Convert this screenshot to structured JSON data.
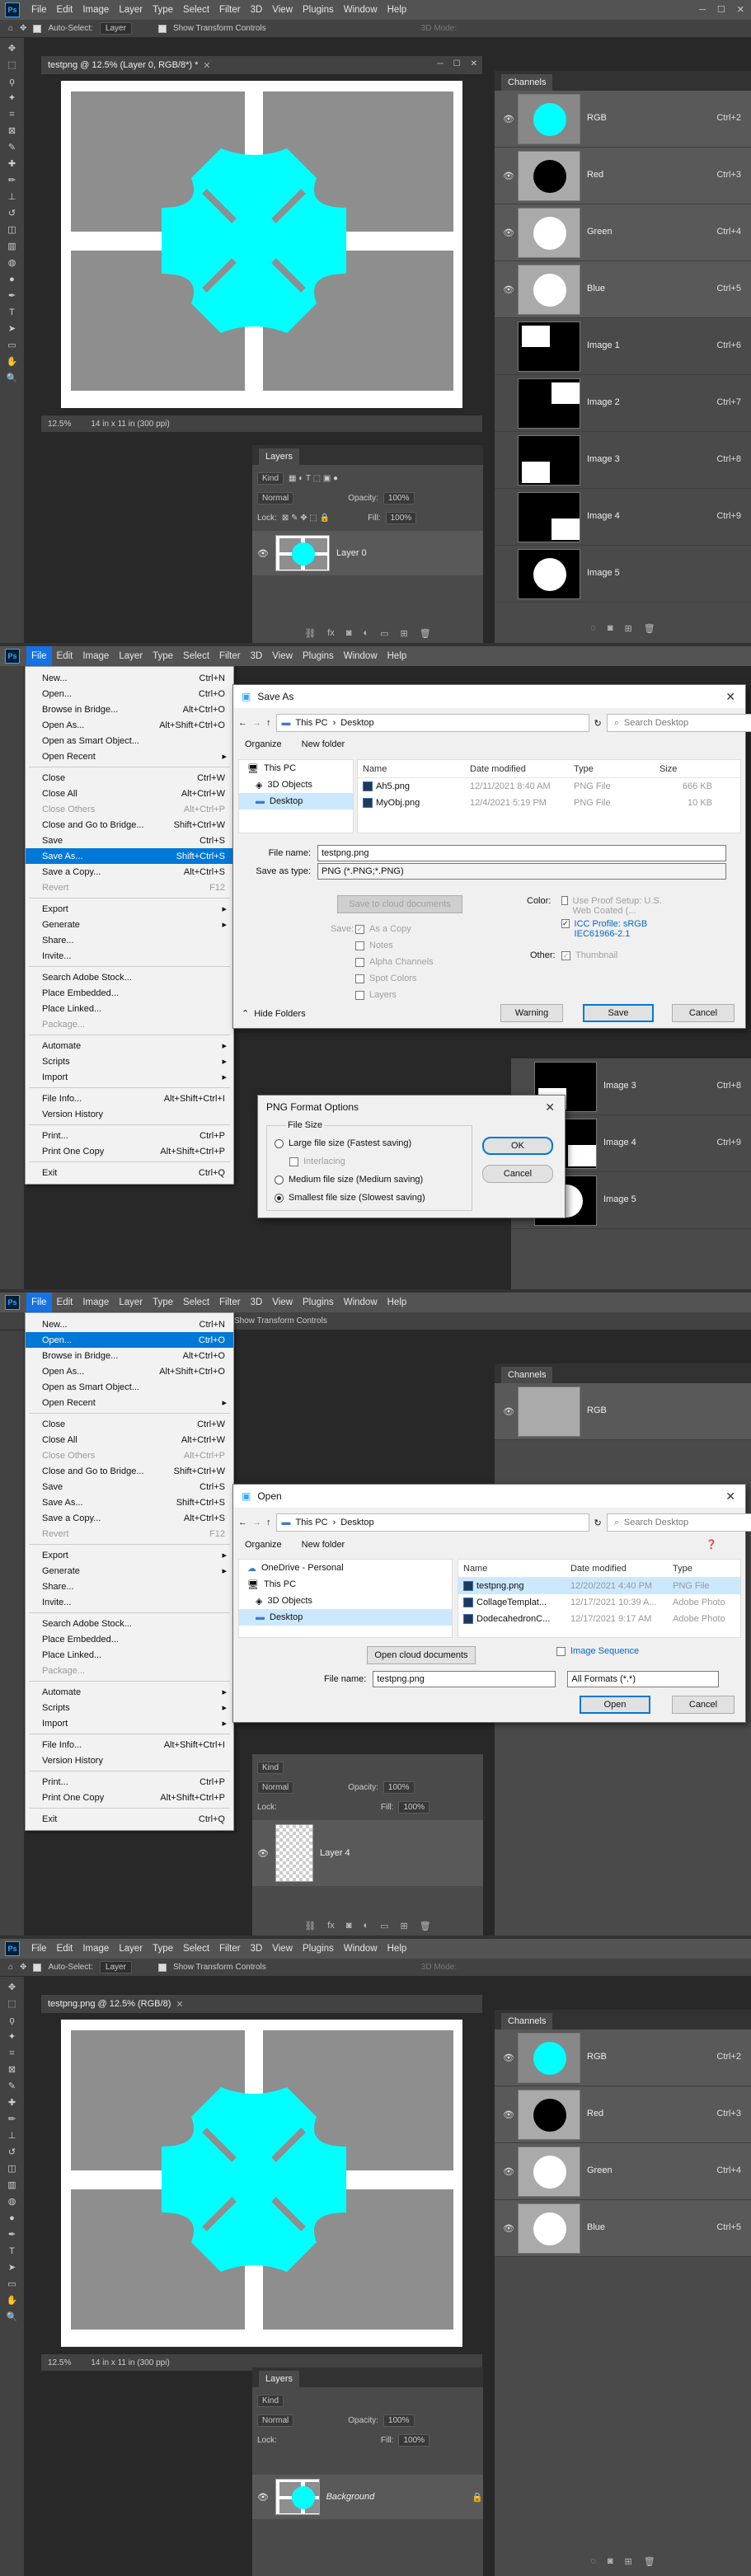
{
  "menubar": {
    "items": [
      "File",
      "Edit",
      "Image",
      "Layer",
      "Type",
      "Select",
      "Filter",
      "3D",
      "View",
      "Plugins",
      "Window",
      "Help"
    ],
    "ps_logo": "Ps"
  },
  "optionsbar": {
    "auto_select": "Auto-Select:",
    "layer_select": "Layer",
    "transform_controls": "Show Transform Controls",
    "mode_3d": "3D Mode:"
  },
  "doc1": {
    "tab_title": "testpng @ 12.5% (Layer 0, RGB/8*) *",
    "zoom": "12.5%",
    "info": "14 in x 11 in (300 ppi)"
  },
  "doc4": {
    "tab_title": "testpng.png @ 12.5% (RGB/8)",
    "zoom": "12.5%",
    "info": "14 in x 11 in (300 ppi)"
  },
  "channels": {
    "tab": "Channels",
    "rows": [
      {
        "name": "RGB",
        "shortcut": "Ctrl+2"
      },
      {
        "name": "Red",
        "shortcut": "Ctrl+3"
      },
      {
        "name": "Green",
        "shortcut": "Ctrl+4"
      },
      {
        "name": "Blue",
        "shortcut": "Ctrl+5"
      },
      {
        "name": "Image 1",
        "shortcut": "Ctrl+6"
      },
      {
        "name": "Image 2",
        "shortcut": "Ctrl+7"
      },
      {
        "name": "Image 3",
        "shortcut": "Ctrl+8"
      },
      {
        "name": "Image 4",
        "shortcut": "Ctrl+9"
      },
      {
        "name": "Image 5",
        "shortcut": ""
      }
    ]
  },
  "layers": {
    "tab": "Layers",
    "kind": "Kind",
    "blend": "Normal",
    "opacity_label": "Opacity:",
    "opacity": "100%",
    "lock_label": "Lock:",
    "fill_label": "Fill:",
    "fill": "100%",
    "layer0": "Layer 0",
    "layer4": "Layer 4",
    "background": "Background"
  },
  "file_menu": {
    "items": [
      {
        "label": "New...",
        "shortcut": "Ctrl+N"
      },
      {
        "label": "Open...",
        "shortcut": "Ctrl+O"
      },
      {
        "label": "Browse in Bridge...",
        "shortcut": "Alt+Ctrl+O"
      },
      {
        "label": "Open As...",
        "shortcut": "Alt+Shift+Ctrl+O"
      },
      {
        "label": "Open as Smart Object...",
        "shortcut": ""
      },
      {
        "label": "Open Recent",
        "shortcut": ""
      },
      {
        "sep": true
      },
      {
        "label": "Close",
        "shortcut": "Ctrl+W"
      },
      {
        "label": "Close All",
        "shortcut": "Alt+Ctrl+W"
      },
      {
        "label": "Close Others",
        "shortcut": "Alt+Ctrl+P"
      },
      {
        "label": "Close and Go to Bridge...",
        "shortcut": "Shift+Ctrl+W"
      },
      {
        "label": "Save",
        "shortcut": "Ctrl+S"
      },
      {
        "label": "Save As...",
        "shortcut": "Shift+Ctrl+S"
      },
      {
        "label": "Save a Copy...",
        "shortcut": "Alt+Ctrl+S"
      },
      {
        "label": "Revert",
        "shortcut": "F12"
      },
      {
        "sep": true
      },
      {
        "label": "Export",
        "shortcut": ""
      },
      {
        "label": "Generate",
        "shortcut": ""
      },
      {
        "label": "Share...",
        "shortcut": ""
      },
      {
        "label": "Invite...",
        "shortcut": ""
      },
      {
        "sep": true
      },
      {
        "label": "Search Adobe Stock...",
        "shortcut": ""
      },
      {
        "label": "Place Embedded...",
        "shortcut": ""
      },
      {
        "label": "Place Linked...",
        "shortcut": ""
      },
      {
        "label": "Package...",
        "shortcut": ""
      },
      {
        "sep": true
      },
      {
        "label": "Automate",
        "shortcut": ""
      },
      {
        "label": "Scripts",
        "shortcut": ""
      },
      {
        "label": "Import",
        "shortcut": ""
      },
      {
        "sep": true
      },
      {
        "label": "File Info...",
        "shortcut": "Alt+Shift+Ctrl+I"
      },
      {
        "label": "Version History",
        "shortcut": ""
      },
      {
        "sep": true
      },
      {
        "label": "Print...",
        "shortcut": "Ctrl+P"
      },
      {
        "label": "Print One Copy",
        "shortcut": "Alt+Shift+Ctrl+P"
      },
      {
        "sep": true
      },
      {
        "label": "Exit",
        "shortcut": "Ctrl+Q"
      }
    ]
  },
  "save_as": {
    "title": "Save As",
    "path": [
      "This PC",
      "Desktop"
    ],
    "search": "Search Desktop",
    "organize": "Organize",
    "new_folder": "New folder",
    "nav": [
      "This PC",
      "3D Objects",
      "Desktop"
    ],
    "columns": [
      "Name",
      "Date modified",
      "Type",
      "Size"
    ],
    "files": [
      {
        "name": "Ah5.png",
        "date": "12/11/2021 8:40 AM",
        "type": "PNG File",
        "size": "666 KB"
      },
      {
        "name": "MyObj.png",
        "date": "12/4/2021 5:19 PM",
        "type": "PNG File",
        "size": "10 KB"
      }
    ],
    "file_name_label": "File name:",
    "file_name": "testpng.png",
    "save_type_label": "Save as type:",
    "save_type": "PNG (*.PNG;*.PNG)",
    "cloud_btn": "Save to cloud documents",
    "color_label": "Color:",
    "proof_setup": "Use Proof Setup: U.S. Web Coated (...",
    "icc": "ICC Profile: sRGB IEC61966-2.1",
    "save_label": "Save:",
    "as_copy": "As a Copy",
    "notes": "Notes",
    "alpha": "Alpha Channels",
    "spot": "Spot Colors",
    "layers": "Layers",
    "other_label": "Other:",
    "thumbnail": "Thumbnail",
    "hide_folders": "Hide Folders",
    "warning_btn": "Warning",
    "save_btn": "Save",
    "cancel_btn": "Cancel"
  },
  "png_options": {
    "title": "PNG Format Options",
    "group": "File Size",
    "large": "Large file size (Fastest saving)",
    "interlacing": "Interlacing",
    "medium": "Medium file size (Medium saving)",
    "smallest": "Smallest file size (Slowest saving)",
    "ok": "OK",
    "cancel": "Cancel"
  },
  "open_dlg": {
    "title": "Open",
    "path": [
      "This PC",
      "Desktop"
    ],
    "search": "Search Desktop",
    "organize": "Organize",
    "new_folder": "New folder",
    "nav": [
      "OneDrive - Personal",
      "This PC",
      "3D Objects",
      "Desktop"
    ],
    "columns": [
      "Name",
      "Date modified",
      "Type"
    ],
    "files": [
      {
        "name": "testpng.png",
        "date": "12/20/2021 4:40 PM",
        "type": "PNG File"
      },
      {
        "name": "CollageTemplat...",
        "date": "12/17/2021 10:39 A...",
        "type": "Adobe Photo"
      },
      {
        "name": "DodecahedronC...",
        "date": "12/17/2021 9:17 AM",
        "type": "Adobe Photo"
      }
    ],
    "cloud_btn": "Open cloud documents",
    "image_sequence": "Image Sequence",
    "file_name_label": "File name:",
    "file_name": "testpng.png",
    "formats": "All Formats (*.*)",
    "open_btn": "Open",
    "cancel_btn": "Cancel"
  },
  "colors": {
    "cyan": "#00ffff",
    "grey_rect": "#8e8e8e",
    "accent": "#0078d7"
  }
}
